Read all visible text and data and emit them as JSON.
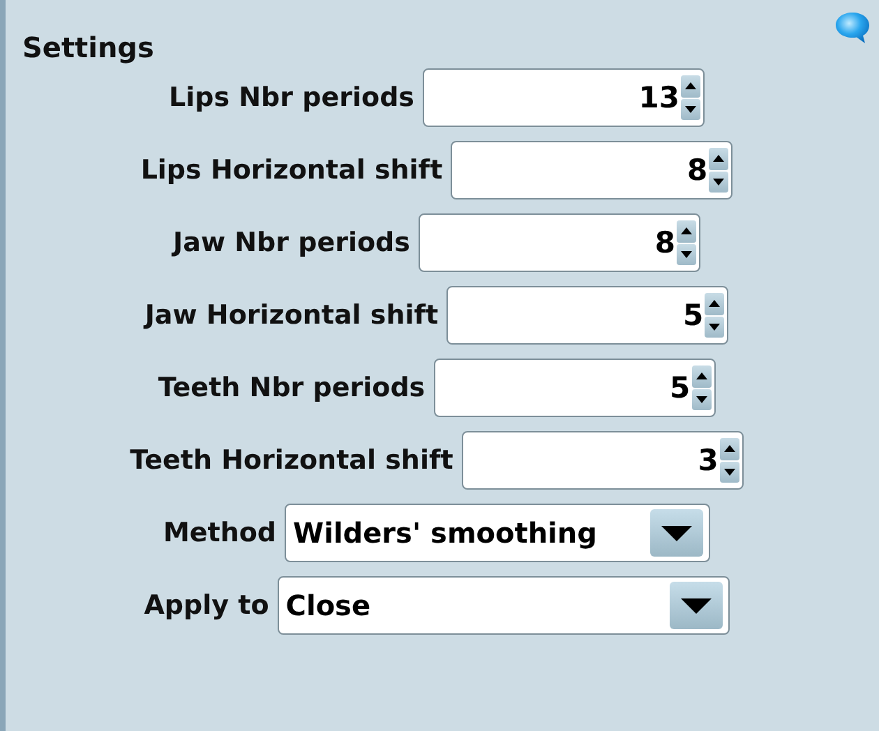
{
  "title": "Settings",
  "fields": [
    {
      "kind": "spinner",
      "label": "Lips Nbr periods",
      "value": "13"
    },
    {
      "kind": "spinner",
      "label": "Lips Horizontal shift",
      "value": "8"
    },
    {
      "kind": "spinner",
      "label": "Jaw Nbr periods",
      "value": "8"
    },
    {
      "kind": "spinner",
      "label": "Jaw Horizontal shift",
      "value": "5"
    },
    {
      "kind": "spinner",
      "label": "Teeth Nbr periods",
      "value": "5"
    },
    {
      "kind": "spinner",
      "label": "Teeth Horizontal shift",
      "value": "3"
    },
    {
      "kind": "dropdown",
      "label": "Method",
      "value": "Wilders' smoothing"
    },
    {
      "kind": "dropdown",
      "label": "Apply to",
      "value": "Close"
    }
  ]
}
